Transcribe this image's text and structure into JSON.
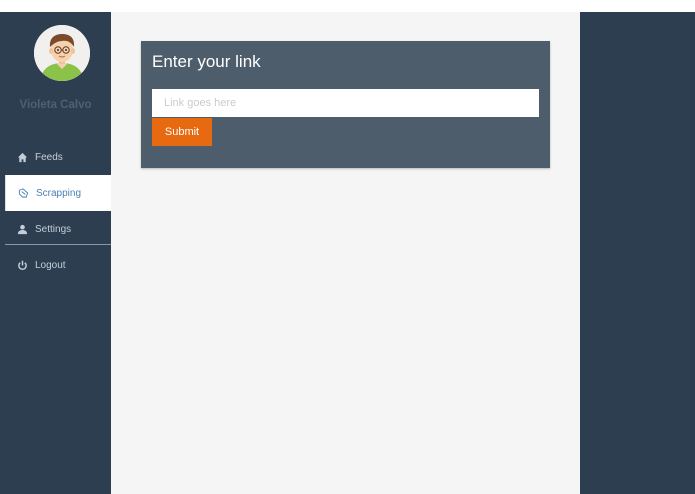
{
  "user": {
    "name": "Violeta Calvo",
    "avatar_icon": "boy-avatar-icon"
  },
  "sidebar": {
    "items": [
      {
        "label": "Feeds",
        "icon": "home-icon",
        "active": false
      },
      {
        "label": "Scrapping",
        "icon": "scrape-hand-icon",
        "active": true
      },
      {
        "label": "Settings",
        "icon": "user-icon",
        "active": false
      },
      {
        "label": "Logout",
        "icon": "power-icon",
        "active": false
      }
    ]
  },
  "link_card": {
    "title": "Enter your link",
    "input_placeholder": "Link goes here",
    "input_value": "",
    "submit_label": "Submit"
  },
  "colors": {
    "sidebar_bg": "#2d3e50",
    "card_bg": "#4e5d6c",
    "accent": "#e86a10",
    "content_bg": "#f5f5f5",
    "active_text": "#4a7fb5"
  }
}
